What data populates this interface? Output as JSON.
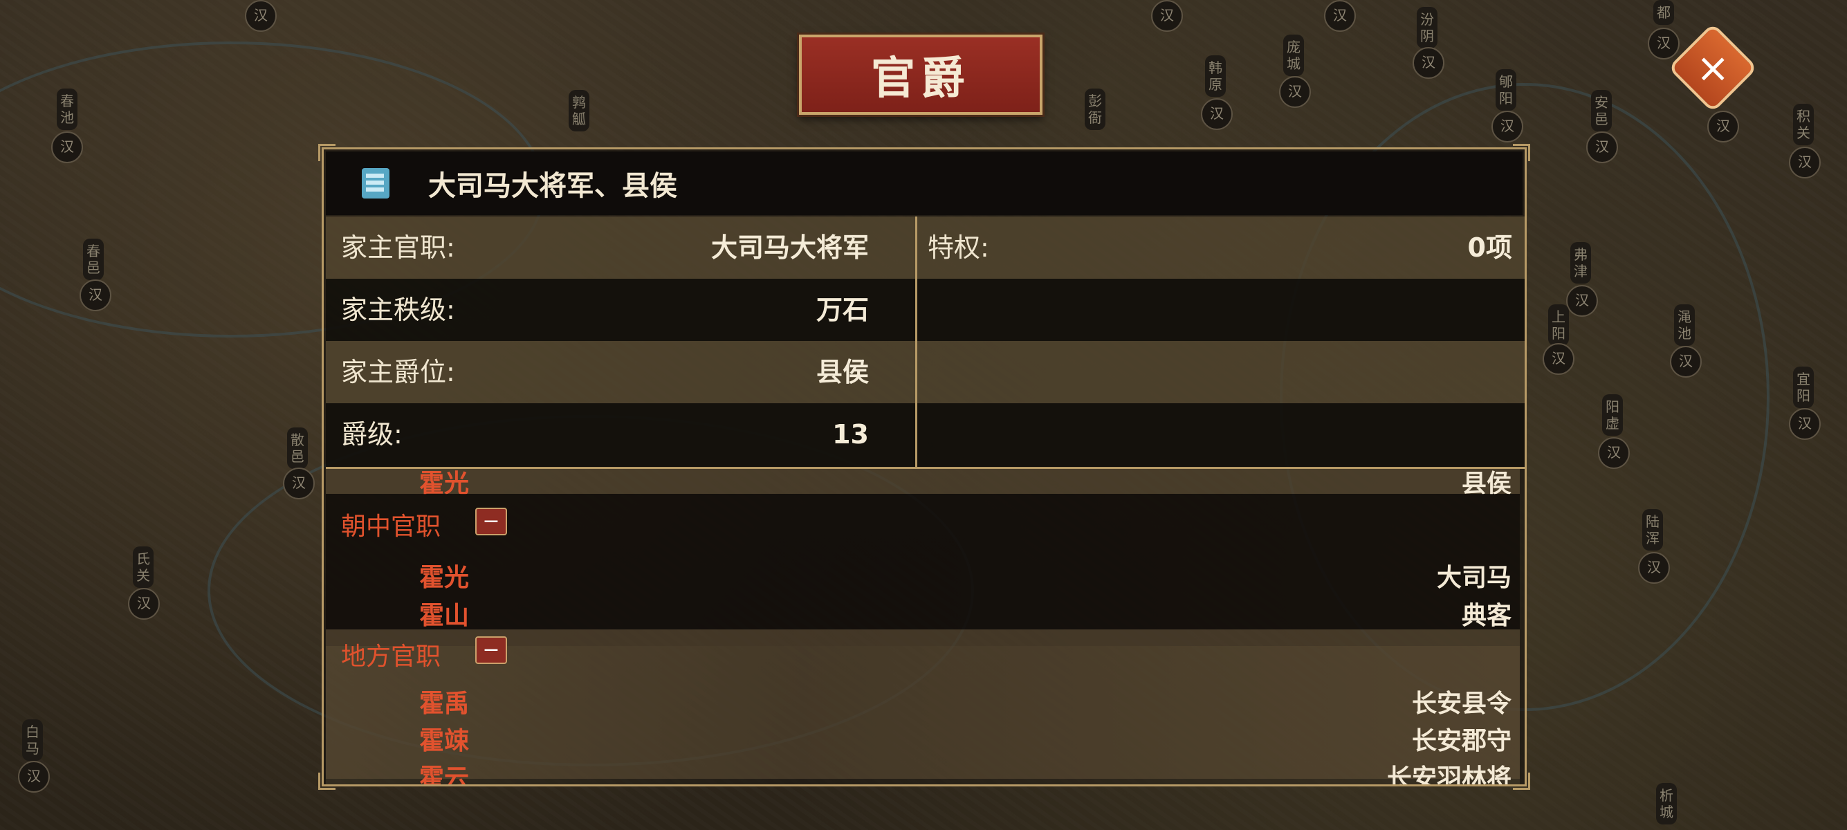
{
  "title": "官爵",
  "header": {
    "text": "大司马大将军、县侯"
  },
  "info_rows": [
    {
      "label": "家主官职:",
      "value": "大司马大将军",
      "right_label": "特权:",
      "right_value": "0项"
    },
    {
      "label": "家主秩级:",
      "value": "万石"
    },
    {
      "label": "家主爵位:",
      "value": "县侯"
    },
    {
      "label": "爵级:",
      "value": "13"
    }
  ],
  "list": {
    "partial_row": {
      "person": "霍光",
      "office": "县侯"
    },
    "sections": [
      {
        "title": "朝中官职",
        "toggle": "−",
        "entries": [
          {
            "person": "霍光",
            "office": "大司马"
          },
          {
            "person": "霍山",
            "office": "典客"
          }
        ]
      },
      {
        "title": "地方官职",
        "toggle": "−",
        "entries": [
          {
            "person": "霍禹",
            "office": "长安县令"
          },
          {
            "person": "霍竦",
            "office": "长安郡守"
          },
          {
            "person": "霍云",
            "office": "长安羽林将"
          }
        ]
      }
    ]
  },
  "close_label": "×",
  "map_labels": [
    "汉",
    "春池",
    "春邑",
    "散邑",
    "氏关",
    "白马",
    "鹑觚",
    "彭衙",
    "韩原",
    "庞城",
    "汾阴",
    "郇阳",
    "安邑",
    "积关",
    "弗津",
    "上阳",
    "渑池",
    "宜阳",
    "阳虚",
    "陆浑",
    "析城",
    "都"
  ]
}
